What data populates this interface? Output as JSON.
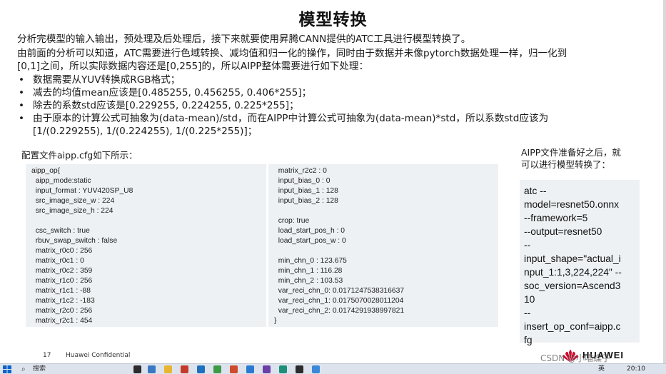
{
  "slide": {
    "title": "模型转换",
    "para1": "分析完模型的输入输出，预处理及后处理后，接下来就要使用昇腾CANN提供的ATC工具进行模型转换了。",
    "para2_line1": "由前面的分析可以知道，ATC需要进行色域转换、减均值和归一化的操作，同时由于数据并未像pytorch数据处理一样，归一化到",
    "para2_line2": "[0,1]之间，所以实际数据内容还是[0,255]的，所以AIPP整体需要进行如下处理：",
    "bullets": [
      "数据需要从YUV转换成RGB格式；",
      "减去的均值mean应该是[0.485255, 0.456255, 0.406*255]；",
      "除去的系数std应该是[0.229255, 0.224255, 0.225*255]；",
      "由于原本的计算公式可抽象为(data-mean)/std，而在AIPP中计算公式可抽象为(data-mean)*std，所以系数std应该为",
      "[1/(0.229255), 1/(0.224255), 1/(0.225*255)]；"
    ],
    "config_caption": "配置文件aipp.cfg如下所示：",
    "right_caption_line1": "AIPP文件准备好之后，就",
    "right_caption_line2": "可以进行模型转换了：",
    "code_left": [
      "aipp_op{",
      "  aipp_mode:static",
      "  input_format : YUV420SP_U8",
      "  src_image_size_w : 224",
      "  src_image_size_h : 224",
      "",
      "  csc_switch : true",
      "  rbuv_swap_switch : false",
      "  matrix_r0c0 : 256",
      "  matrix_r0c1 : 0",
      "  matrix_r0c2 : 359",
      "  matrix_r1c0 : 256",
      "  matrix_r1c1 : -88",
      "  matrix_r1c2 : -183",
      "  matrix_r2c0 : 256",
      "  matrix_r2c1 : 454"
    ],
    "code_mid": [
      "  matrix_r2c2 : 0",
      "  input_bias_0 : 0",
      "  input_bias_1 : 128",
      "  input_bias_2 : 128",
      "",
      "  crop: true",
      "  load_start_pos_h : 0",
      "  load_start_pos_w : 0",
      "",
      "  min_chn_0 : 123.675",
      "  min_chn_1 : 116.28",
      "  min_chn_2 : 103.53",
      "  var_reci_chn_0: 0.0171247538316637",
      "  var_reci_chn_1: 0.0175070028011204",
      "  var_reci_chn_2: 0.0174291938997821",
      "}"
    ],
    "command": [
      "atc --",
      "model=resnet50.onnx",
      "--framework=5",
      "--output=resnet50",
      "--",
      "input_shape=\"actual_i",
      "nput_1:1,3,224,224\" --",
      "soc_version=Ascend3",
      "10",
      "--",
      "insert_op_conf=aipp.c",
      "fg"
    ],
    "page_number": "17",
    "confidential": "Huawei Confidential",
    "brand": "HUAWEI",
    "watermark": "CSDN @小喵蝶子"
  },
  "taskbar": {
    "search_placeholder": "搜索",
    "ime": "英",
    "time": "20:10"
  },
  "colors": {
    "code_bg": "#eef1f4",
    "huawei_red": "#cf0a2c",
    "taskbar_bg": "#dde3ec"
  }
}
